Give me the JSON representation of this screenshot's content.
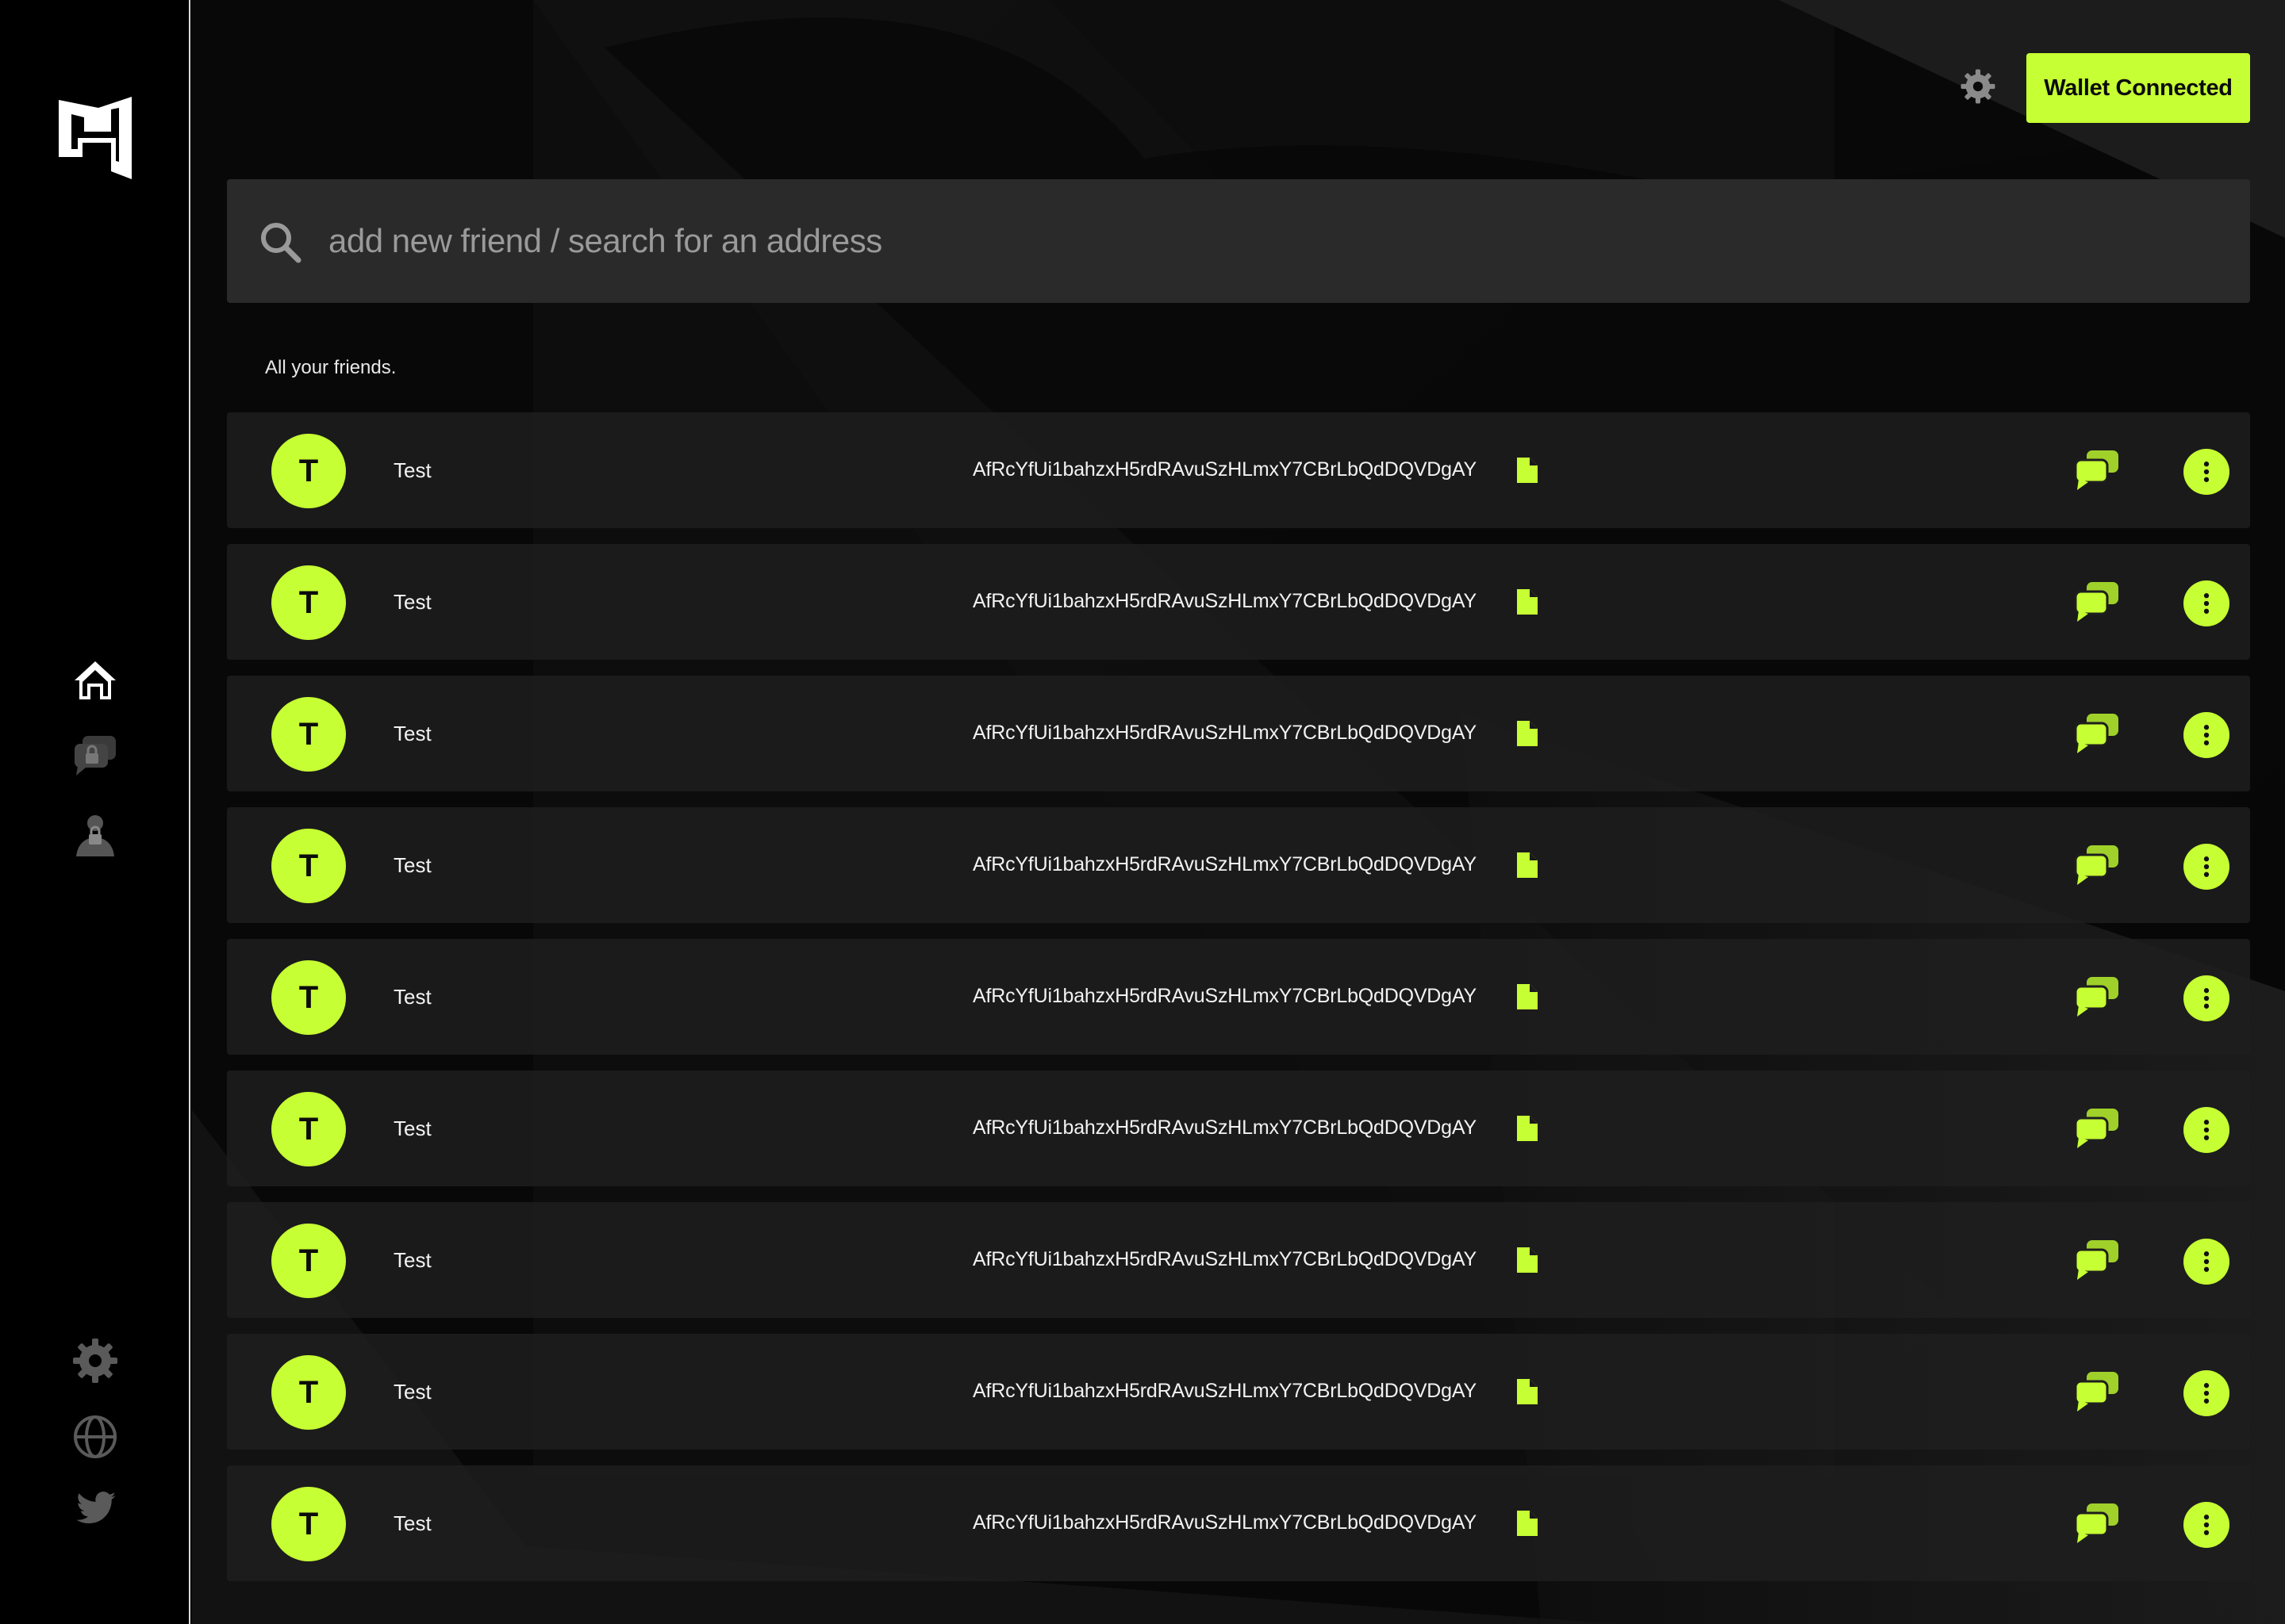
{
  "colors": {
    "accent": "#c6ff33",
    "background": "#000000",
    "panel": "#2a2a2a",
    "row": "#1e1e1e",
    "text": "#ffffff",
    "muted": "#9a9a9a"
  },
  "sidebar": {
    "logo": "app-logo",
    "nav": [
      {
        "name": "home",
        "icon": "home-icon",
        "active": true
      },
      {
        "name": "private-chats",
        "icon": "locked-chat-icon",
        "active": false
      },
      {
        "name": "anonymous-profile",
        "icon": "locked-user-icon",
        "active": false
      }
    ],
    "footer": [
      {
        "name": "settings",
        "icon": "gear-icon"
      },
      {
        "name": "website",
        "icon": "globe-icon"
      },
      {
        "name": "twitter",
        "icon": "twitter-icon"
      }
    ]
  },
  "header": {
    "settings_icon": "gear-icon",
    "wallet_label": "Wallet Connected"
  },
  "search": {
    "placeholder": "add new friend / search for an address",
    "icon": "search-icon"
  },
  "friends": {
    "title": "All your friends.",
    "items": [
      {
        "initial": "T",
        "name": "Test",
        "address": "AfRcYfUi1bahzxH5rdRAvuSzHLmxY7CBrLbQdDQVDgAY"
      },
      {
        "initial": "T",
        "name": "Test",
        "address": "AfRcYfUi1bahzxH5rdRAvuSzHLmxY7CBrLbQdDQVDgAY"
      },
      {
        "initial": "T",
        "name": "Test",
        "address": "AfRcYfUi1bahzxH5rdRAvuSzHLmxY7CBrLbQdDQVDgAY"
      },
      {
        "initial": "T",
        "name": "Test",
        "address": "AfRcYfUi1bahzxH5rdRAvuSzHLmxY7CBrLbQdDQVDgAY"
      },
      {
        "initial": "T",
        "name": "Test",
        "address": "AfRcYfUi1bahzxH5rdRAvuSzHLmxY7CBrLbQdDQVDgAY"
      },
      {
        "initial": "T",
        "name": "Test",
        "address": "AfRcYfUi1bahzxH5rdRAvuSzHLmxY7CBrLbQdDQVDgAY"
      },
      {
        "initial": "T",
        "name": "Test",
        "address": "AfRcYfUi1bahzxH5rdRAvuSzHLmxY7CBrLbQdDQVDgAY"
      },
      {
        "initial": "T",
        "name": "Test",
        "address": "AfRcYfUi1bahzxH5rdRAvuSzHLmxY7CBrLbQdDQVDgAY"
      },
      {
        "initial": "T",
        "name": "Test",
        "address": "AfRcYfUi1bahzxH5rdRAvuSzHLmxY7CBrLbQdDQVDgAY"
      }
    ],
    "row_icons": {
      "copy": "copy-file-icon",
      "chat": "chat-icon",
      "more": "more-options-icon"
    }
  }
}
